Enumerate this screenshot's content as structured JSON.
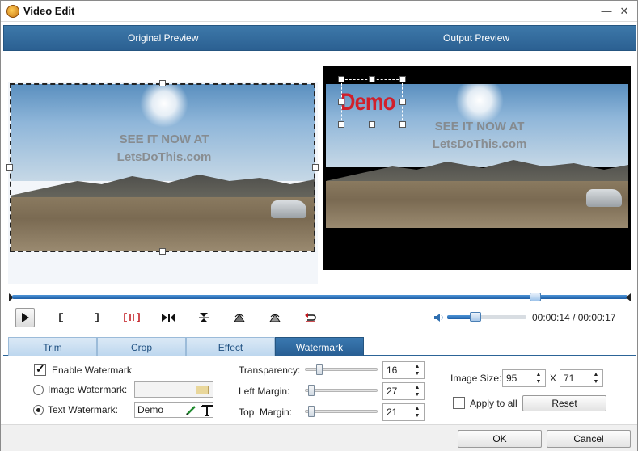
{
  "window": {
    "title": "Video Edit",
    "minimize_glyph": "—",
    "close_glyph": "✕"
  },
  "preview": {
    "original_label": "Original Preview",
    "output_label": "Output Preview",
    "source_watermark_line1": "SEE IT NOW AT",
    "source_watermark_line2": "LetsDoThis.com",
    "text_watermark": "Demo"
  },
  "timeline": {
    "position_fraction": 0.85
  },
  "playback": {
    "current_time": "00:00:14",
    "total_time": "00:00:17",
    "separator": "/",
    "volume_fraction": 0.36
  },
  "tabs": [
    {
      "label": "Trim",
      "active": false
    },
    {
      "label": "Crop",
      "active": false
    },
    {
      "label": "Effect",
      "active": false
    },
    {
      "label": "Watermark",
      "active": true
    }
  ],
  "watermark": {
    "enable_label": "Enable Watermark",
    "enable_checked": true,
    "image_label": "Image Watermark:",
    "image_value": "",
    "text_label": "Text Watermark:",
    "text_value": "Demo",
    "selected_mode": "text",
    "transparency_label": "Transparency:",
    "transparency_value": "16",
    "left_margin_label": "Left Margin:",
    "left_margin_value": "27",
    "top_margin_label": "Top  Margin:",
    "top_margin_value": "21",
    "image_size_label": "Image Size:",
    "image_width": "95",
    "image_height": "71",
    "size_separator": "X",
    "apply_all_label": "Apply to all",
    "apply_all_checked": false,
    "reset_label": "Reset"
  },
  "footer": {
    "ok_label": "OK",
    "cancel_label": "Cancel"
  },
  "colors": {
    "accent": "#2c6497",
    "watermark_red": "#d11f2a",
    "timeline_blue": "#1f5fa6"
  }
}
